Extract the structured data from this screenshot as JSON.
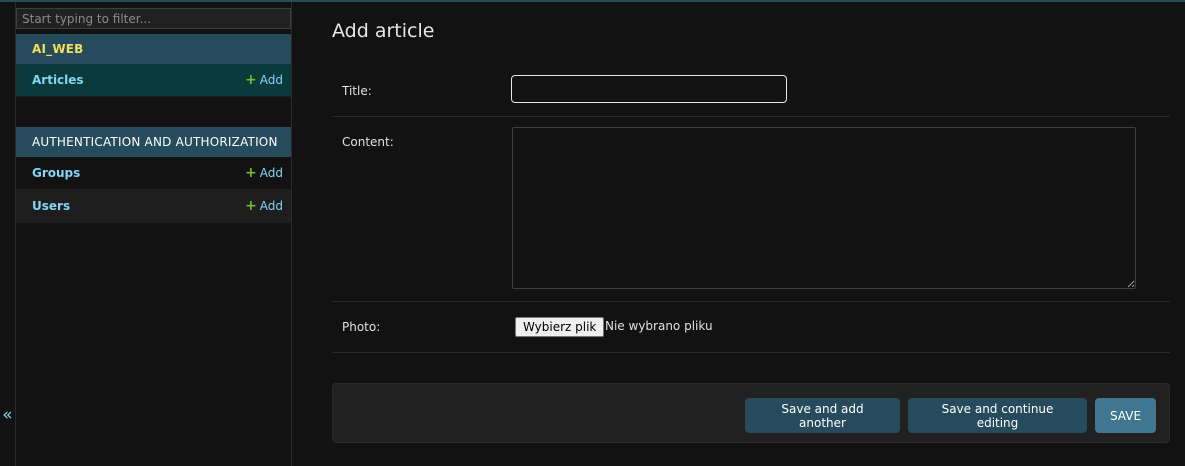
{
  "sidebar": {
    "filter_placeholder": "Start typing to filter...",
    "collapse_glyph": "«",
    "modules": [
      {
        "name": "AI_WEB",
        "models": [
          {
            "label": "Articles",
            "add_label": "Add",
            "add_icon": "plus-icon"
          }
        ]
      },
      {
        "name": "AUTHENTICATION AND AUTHORIZATION",
        "models": [
          {
            "label": "Groups",
            "add_label": "Add",
            "add_icon": "plus-icon"
          },
          {
            "label": "Users",
            "add_label": "Add",
            "add_icon": "plus-icon"
          }
        ]
      }
    ]
  },
  "form": {
    "title": "Add article",
    "fields": {
      "title_label": "Title:",
      "title_value": "",
      "content_label": "Content:",
      "content_value": "",
      "photo_label": "Photo:",
      "file_button": "Wybierz plik",
      "file_status": "Nie wybrano pliku"
    },
    "buttons": {
      "save_add_another": "Save and add another",
      "save_continue": "Save and continue editing",
      "save": "SAVE"
    }
  },
  "colors": {
    "header_bg": "#264b5d",
    "active_row_bg": "#0b3a3a",
    "link": "#81d4fa",
    "app_name": "#f5dd5d",
    "add_plus": "#70bf2b",
    "primary_button": "#417690"
  }
}
